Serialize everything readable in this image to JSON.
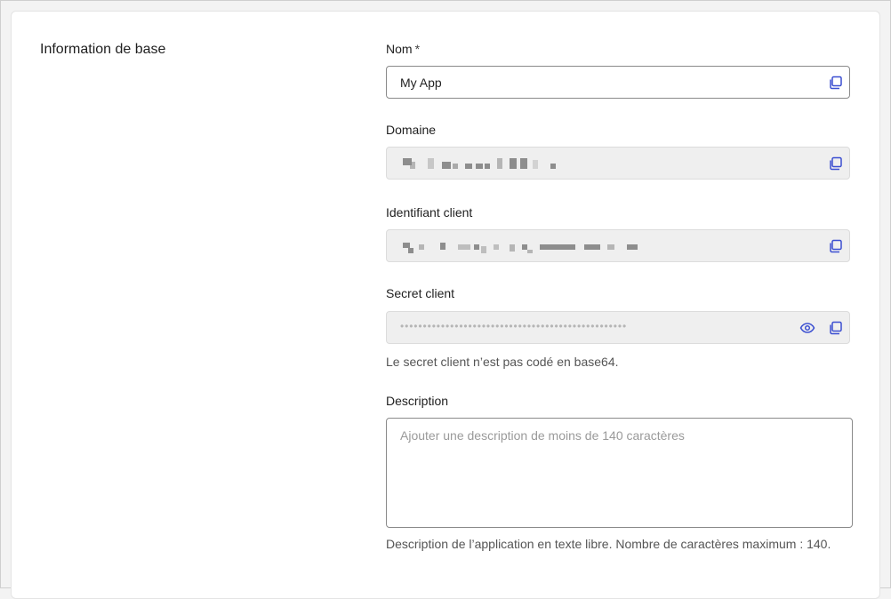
{
  "section": {
    "title": "Information de base"
  },
  "name": {
    "label": "Nom",
    "required_mark": "*",
    "value": "My App"
  },
  "domain": {
    "label": "Domaine"
  },
  "client_id": {
    "label": "Identifiant client"
  },
  "client_secret": {
    "label": "Secret client",
    "masked_value": "••••••••••••••••••••••••••••••••••••••••••••••••••",
    "helper": "Le secret client n’est pas codé en base64."
  },
  "description": {
    "label": "Description",
    "placeholder": "Ajouter une description de moins de 140 caractères",
    "helper": "Description de l’application en texte libre. Nombre de caractères maximum : 140."
  },
  "colors": {
    "accent": "#3b4fd1",
    "field_readonly_bg": "#efefef",
    "helper_text": "#555555"
  },
  "icons": {
    "copy": "copy-icon",
    "reveal": "eye-icon"
  }
}
